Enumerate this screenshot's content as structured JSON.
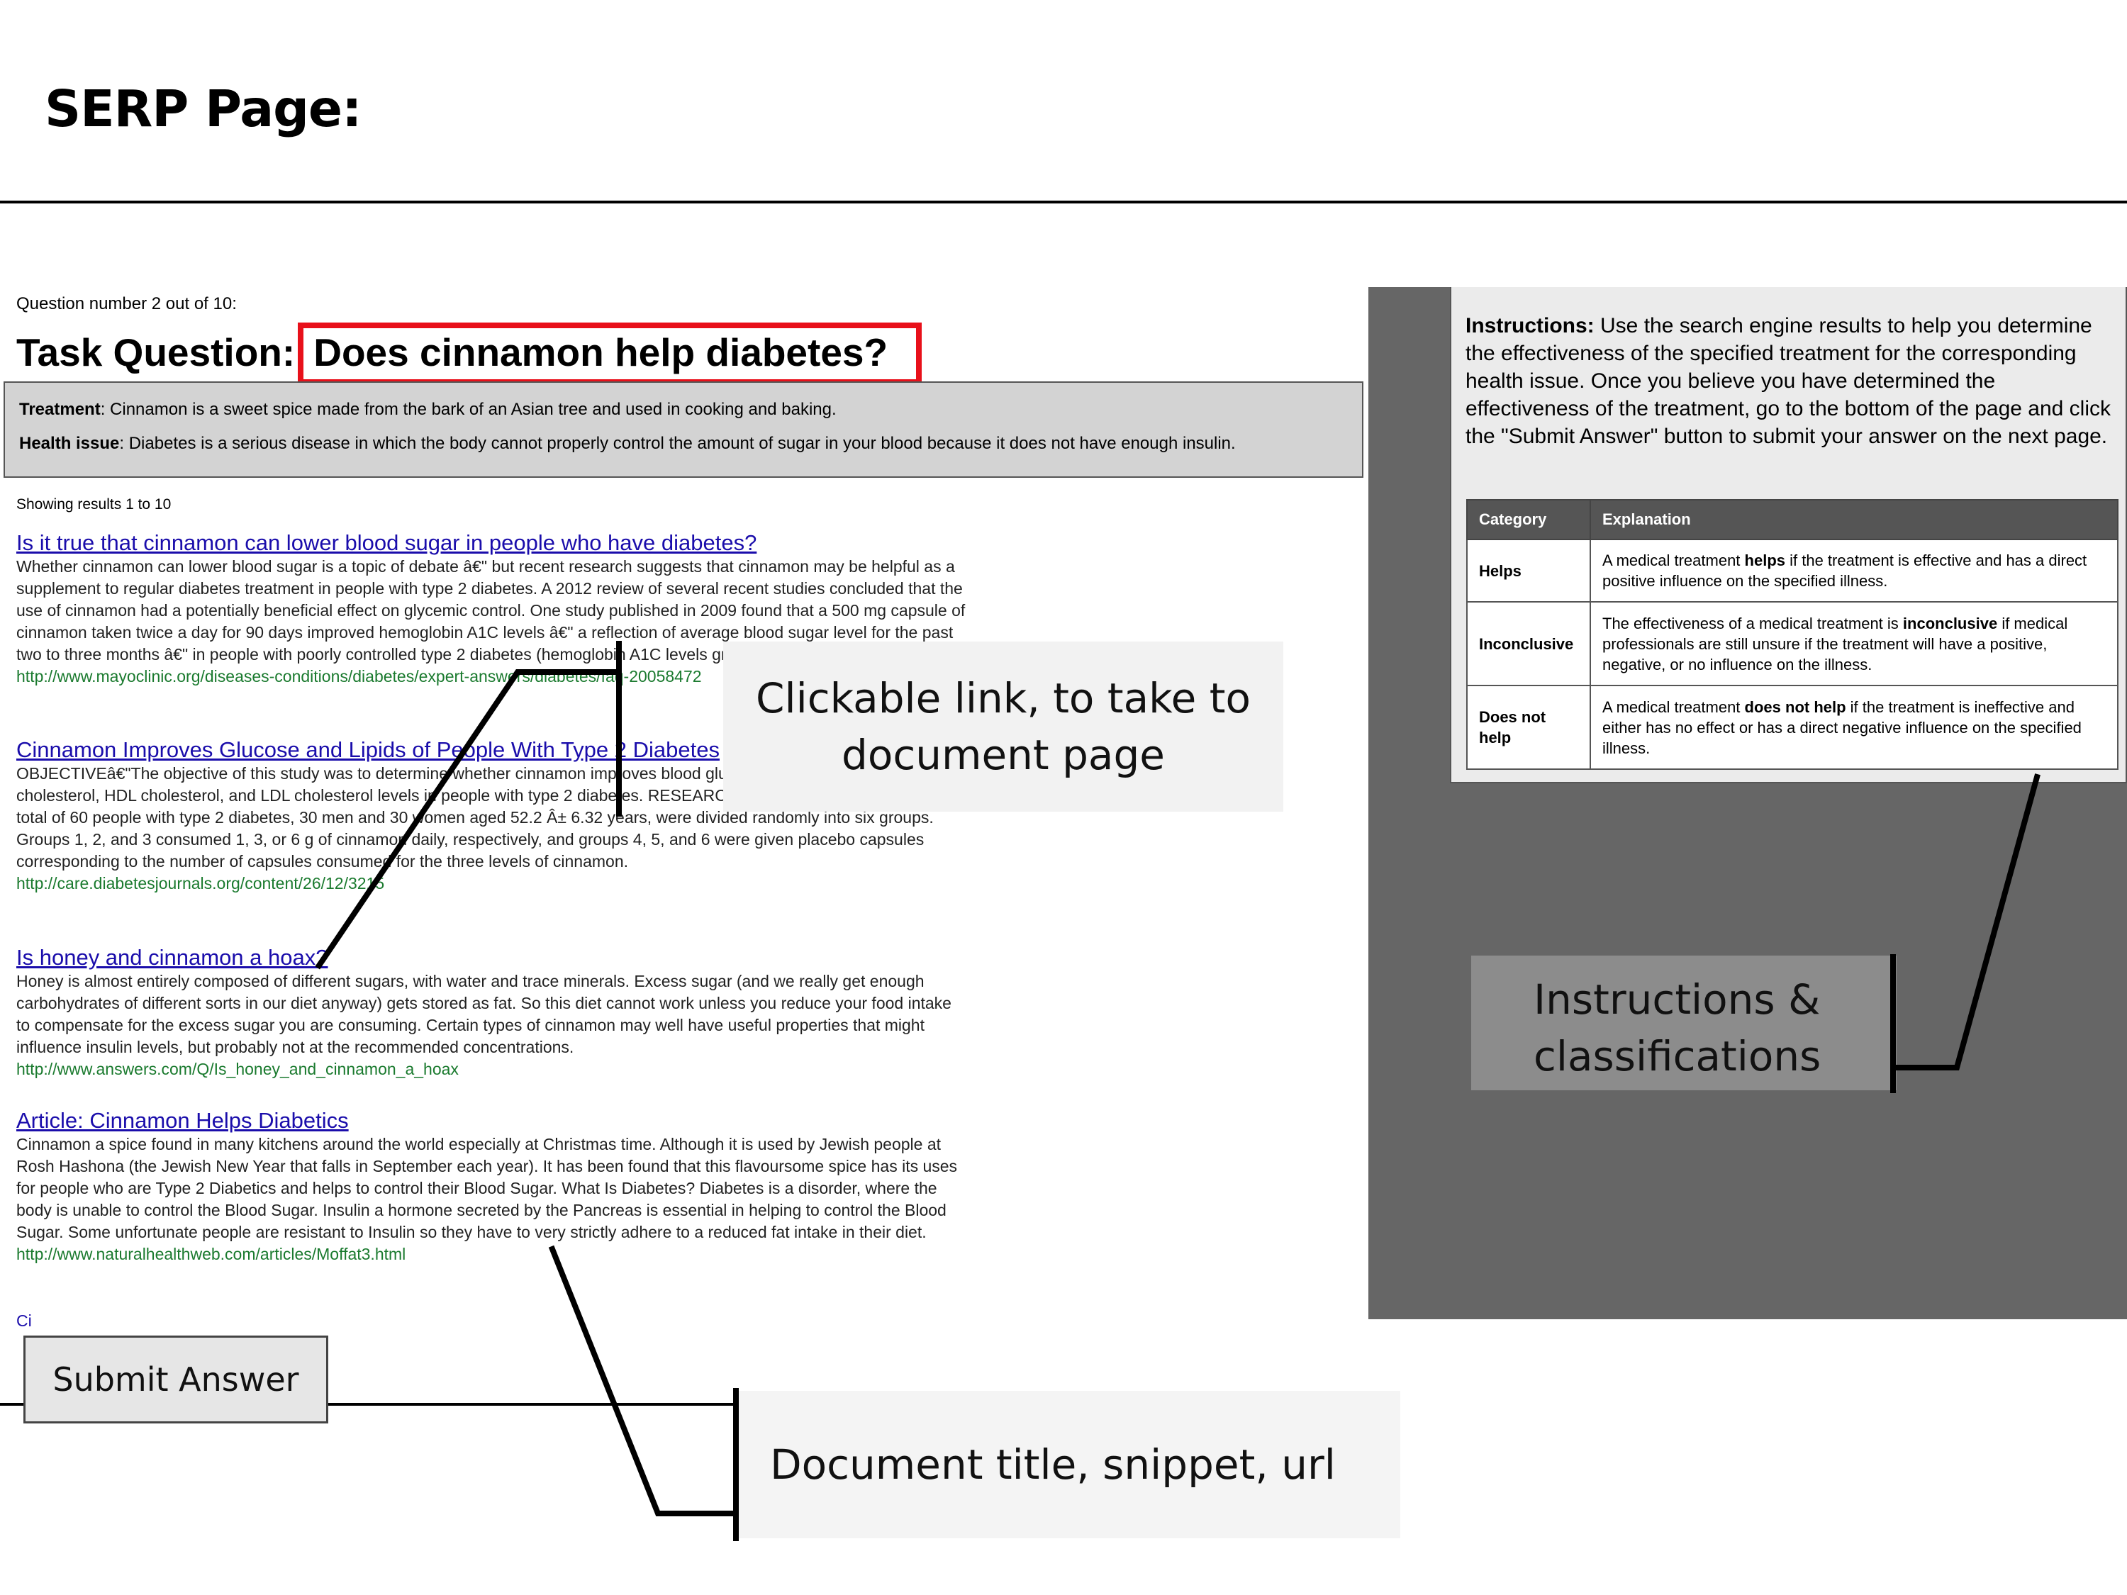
{
  "slide_title": "SERP Page:",
  "serp": {
    "question_number": "Question number 2 out of 10:",
    "task_label": "Task Question:",
    "task_question": "Does cinnamon help diabetes?",
    "treatment_label": "Treatment",
    "treatment_text": ": Cinnamon is a sweet spice made from the bark of an Asian tree and used in cooking and baking.",
    "health_label": "Health issue",
    "health_text": ": Diabetes is a serious disease in which the body cannot properly control the amount of sugar in your blood because it does not have enough insulin.",
    "showing": "Showing results 1 to 10",
    "results": [
      {
        "title": "Is it true that cinnamon can lower blood sugar in people who have diabetes?",
        "snippet": "Whether cinnamon can lower blood sugar is a topic of debate â€\" but recent research suggests that cinnamon may be helpful as a supplement to regular diabetes treatment in people with type 2 diabetes. A 2012 review of several recent studies concluded that the use of cinnamon had a potentially beneficial effect on glycemic control. One study published in 2009 found that a 500 mg capsule of cinnamon taken twice a day for 90 days improved hemoglobin A1C levels â€\" a reflection of average blood sugar level for the past two to three months â€\" in people with poorly controlled type 2 diabetes (hemoglobin A1C levels greater than 7 percent).",
        "url": "http://www.mayoclinic.org/diseases-conditions/diabetes/expert-answers/diabetes/faq-20058472"
      },
      {
        "title": "Cinnamon Improves Glucose and Lipids of People With Type 2 Diabetes",
        "snippet": "OBJECTIVEâ€\"The objective of this study was to determine whether cinnamon improves blood glucose, triglyceride, total cholesterol, HDL cholesterol, and LDL cholesterol levels in people with type 2 diabetes. RESEARCH DESIGN AND METHODSâ€\"A total of 60 people with type 2 diabetes, 30 men and 30 women aged 52.2 Â± 6.32 years, were divided randomly into six groups. Groups 1, 2, and 3 consumed 1, 3, or 6 g of cinnamon daily, respectively, and groups 4, 5, and 6 were given placebo capsules corresponding to the number of capsules consumed for the three levels of cinnamon.",
        "url": "http://care.diabetesjournals.org/content/26/12/3215"
      },
      {
        "title": "Is honey and cinnamon a hoax?",
        "snippet": "Honey is almost entirely composed of different sugars, with water and trace minerals. Excess sugar (and we really get enough carbohydrates of different sorts in our diet anyway) gets stored as fat. So this diet cannot work unless you reduce your food intake to compensate for the excess sugar you are consuming. Certain types of cinnamon may well have useful properties that might influence insulin levels, but probably not at the recommended concentrations.",
        "url": "http://www.answers.com/Q/Is_honey_and_cinnamon_a_hoax"
      },
      {
        "title": "Article: Cinnamon Helps Diabetics",
        "snippet": "Cinnamon a spice found in many kitchens around the world especially at Christmas time. Although it is used by Jewish people at Rosh Hashona (the Jewish New Year that falls in September each year). It has been found that this flavoursome spice has its uses for people who are Type 2 Diabetics and helps to control their Blood Sugar. What Is Diabetes? Diabetes is a disorder, where the body is unable to control the Blood Sugar. Insulin a hormone secreted by the Pancreas is essential in helping to control the Blood Sugar. Some unfortunate people are resistant to Insulin so they have to very strictly adhere to a reduced fat intake in their diet.",
        "url": "http://www.naturalhealthweb.com/articles/Moffat3.html"
      }
    ],
    "partial_next": "Ci",
    "submit_label": "Submit Answer"
  },
  "instructions": {
    "label": "Instructions:",
    "text": " Use the search engine results to help you determine the effectiveness of the specified treatment for the corresponding health issue. Once you believe you have determined the effectiveness of the treatment, go to the bottom of the page and click the \"Submit Answer\" button to submit your answer on the next page.",
    "table_headers": [
      "Category",
      "Explanation"
    ],
    "rows": [
      {
        "category": "Helps",
        "pre": "A medical treatment ",
        "bold": "helps",
        "post": " if the treatment is effective and has a direct positive influence on the specified illness."
      },
      {
        "category": "Inconclusive",
        "pre": "The effectiveness of a medical treatment is ",
        "bold": "inconclusive",
        "post": " if medical professionals are still unsure if the treatment will have a positive, negative, or no influence on the illness."
      },
      {
        "category": "Does not help",
        "pre": "A medical treatment ",
        "bold": "does not help",
        "post": " if the treatment is ineffective and either has no effect or has a direct negative influence on the specified illness."
      }
    ]
  },
  "callouts": {
    "link_line1": "Clickable link, to take to",
    "link_line2": "document page",
    "instr_line1": "Instructions &",
    "instr_line2": "classifications",
    "doc": "Document title, snippet, url"
  }
}
